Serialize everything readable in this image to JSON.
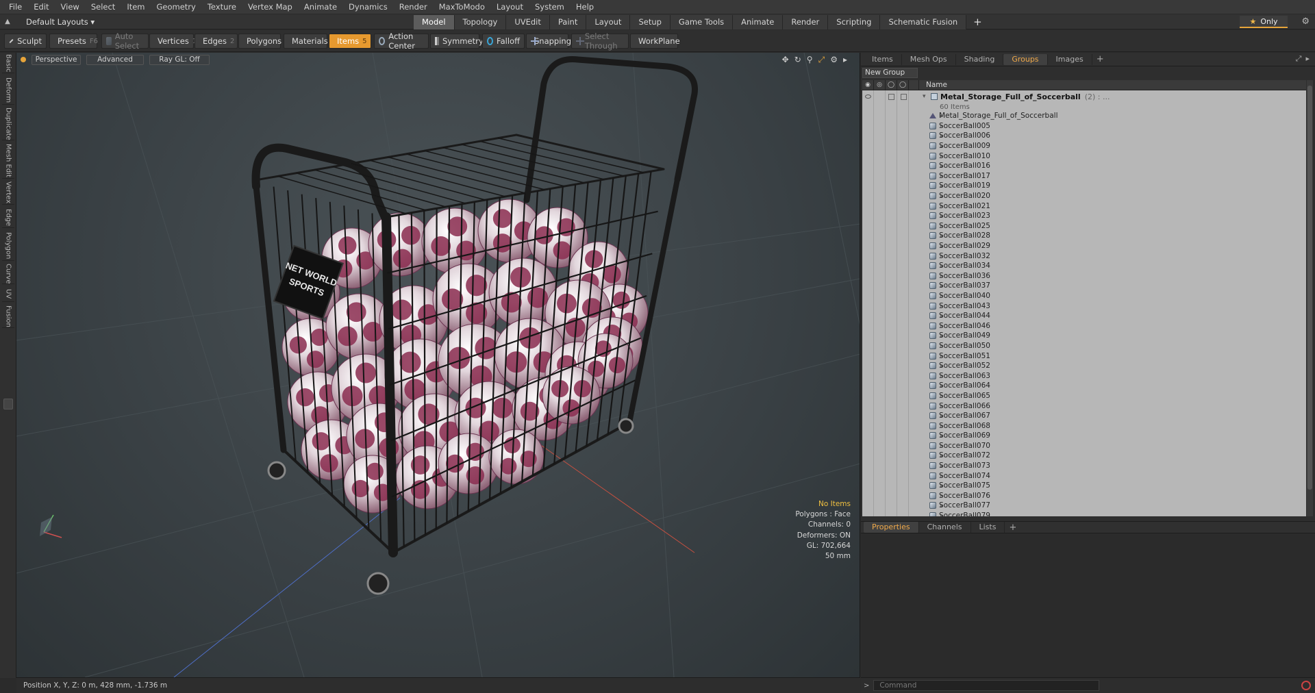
{
  "menu": [
    "File",
    "Edit",
    "View",
    "Select",
    "Item",
    "Geometry",
    "Texture",
    "Vertex Map",
    "Animate",
    "Dynamics",
    "Render",
    "MaxToModo",
    "Layout",
    "System",
    "Help"
  ],
  "layout": {
    "selector": "Default Layouts ▾",
    "tabs": [
      "Model",
      "Topology",
      "UVEdit",
      "Paint",
      "Layout",
      "Setup",
      "Game Tools",
      "Animate",
      "Render",
      "Scripting",
      "Schematic Fusion"
    ],
    "active_tab": "Model",
    "add_tab": "+",
    "only_label": "Only"
  },
  "toolbar": {
    "sculpt": "Sculpt",
    "presets": "Presets",
    "presets_key": "F6",
    "auto_select": "Auto Select",
    "vertices": "Vertices",
    "vertices_key": "1",
    "edges": "Edges",
    "edges_key": "2",
    "polygons": "Polygons",
    "materials": "Materials",
    "items": "Items",
    "items_key": "5",
    "action_center": "Action Center",
    "symmetry": "Symmetry",
    "falloff": "Falloff",
    "snapping": "Snapping",
    "select_through": "Select Through",
    "workplane": "WorkPlane"
  },
  "left_tabs": [
    "Basic",
    "Deform",
    "Duplicate",
    "Mesh Edit",
    "Vertex",
    "Edge",
    "Polygon",
    "Curve",
    "UV",
    "Fusion"
  ],
  "viewport": {
    "view": "Perspective",
    "shading": "Advanced",
    "raygl": "Ray GL: Off",
    "sign_text": "NET WORLD SPORTS",
    "info": {
      "selection": "No Items",
      "polygons": "Polygons : Face",
      "channels": "Channels: 0",
      "deformers": "Deformers: ON",
      "gl": "GL: 702,664",
      "scale": "50 mm"
    }
  },
  "status": {
    "position": "Position X, Y, Z:  0 m, 428 mm, -1.736 m"
  },
  "right_panel": {
    "tabs": [
      "Items",
      "Mesh Ops",
      "Shading",
      "Groups",
      "Images"
    ],
    "active_tab": "Groups",
    "new_group": "New Group",
    "column_name": "Name",
    "group_name": "Metal_Storage_Full_of_Soccerball",
    "group_count": "(2) : ...",
    "group_items": "60 Items",
    "mesh_item": "Metal_Storage_Full_of_Soccerball",
    "items": [
      "SoccerBall005",
      "SoccerBall006",
      "SoccerBall009",
      "SoccerBall010",
      "SoccerBall016",
      "SoccerBall017",
      "SoccerBall019",
      "SoccerBall020",
      "SoccerBall021",
      "SoccerBall023",
      "SoccerBall025",
      "SoccerBall028",
      "SoccerBall029",
      "SoccerBall032",
      "SoccerBall034",
      "SoccerBall036",
      "SoccerBall037",
      "SoccerBall040",
      "SoccerBall043",
      "SoccerBall044",
      "SoccerBall046",
      "SoccerBall049",
      "SoccerBall050",
      "SoccerBall051",
      "SoccerBall052",
      "SoccerBall063",
      "SoccerBall064",
      "SoccerBall065",
      "SoccerBall066",
      "SoccerBall067",
      "SoccerBall068",
      "SoccerBall069",
      "SoccerBall070",
      "SoccerBall072",
      "SoccerBall073",
      "SoccerBall074",
      "SoccerBall075",
      "SoccerBall076",
      "SoccerBall077",
      "SoccerBall079"
    ],
    "bottom_tabs": [
      "Properties",
      "Channels",
      "Lists"
    ],
    "bottom_active": "Properties",
    "command_placeholder": "Command"
  },
  "colors": {
    "accent": "#e6992f",
    "active_tab_text": "#f0a94a",
    "info_highlight": "#f0c040",
    "ball_primary": "#8a2c4f",
    "ball_secondary": "#e8e4e6"
  }
}
